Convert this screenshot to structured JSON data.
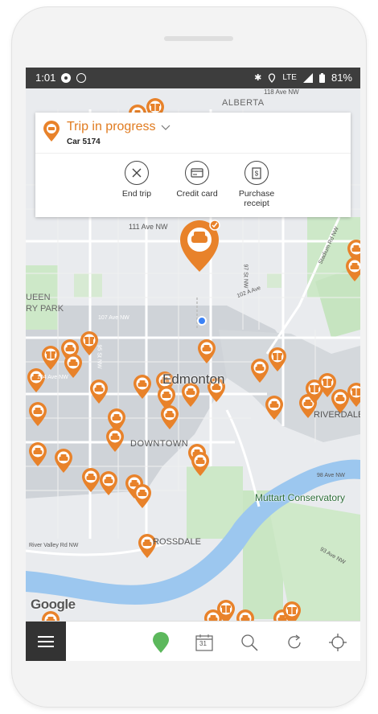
{
  "status_bar": {
    "time": "1:01",
    "battery": "81%",
    "network": "LTE"
  },
  "trip_card": {
    "title": "Trip in progress",
    "car": "Car 5174",
    "actions": [
      {
        "label": "End trip",
        "icon": "close-icon"
      },
      {
        "label": "Credit card",
        "icon": "credit-card-icon"
      },
      {
        "label": "Purchase receipt",
        "icon": "receipt-icon"
      }
    ]
  },
  "map": {
    "labels": {
      "alberta": "ALBERTA",
      "ave118": "118 Ave NW",
      "ave111": "111 Ave NW",
      "ave107": "107 Ave NW",
      "ave104": "104 Ave NW",
      "ave102": "102 A Ave",
      "queen": "UEEN",
      "park": "RY PARK",
      "edmonton": "Edmonton",
      "downtown": "DOWNTOWN",
      "riverdale": "RIVERDALE",
      "muttart": "Muttart Conservatory",
      "rossdale": "ROSSDALE",
      "rivervalley": "River Valley Rd NW",
      "stadium": "Stadium Rd NW",
      "ave98": "98 Ave NW",
      "st97": "97 St NW",
      "st95": "95 St NW",
      "ave93": "93 Ave NW",
      "google": "Google"
    },
    "accent_color": "#e8822a"
  },
  "bottom_nav": {
    "calendar_day": "31",
    "items": [
      "menu-icon",
      "map-pin-icon",
      "calendar-icon",
      "search-icon",
      "refresh-icon",
      "locate-icon"
    ]
  }
}
